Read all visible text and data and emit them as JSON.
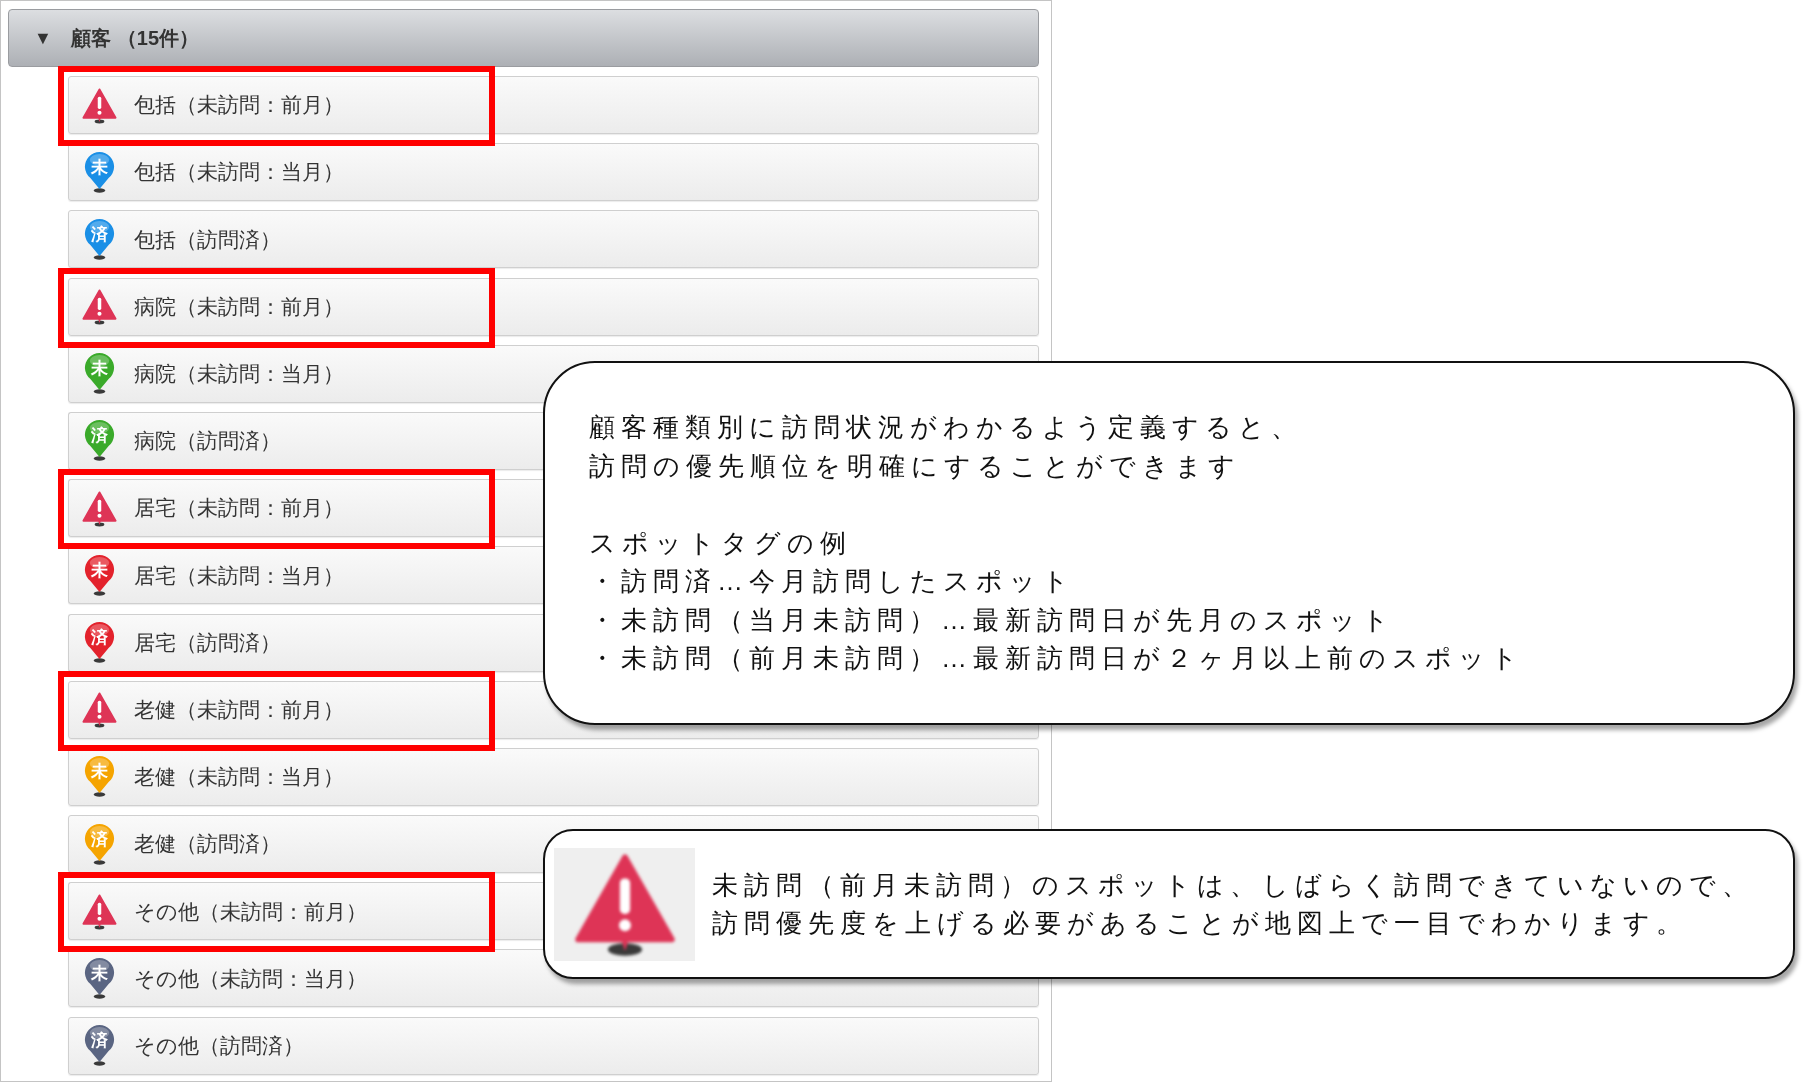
{
  "panel": {
    "header": {
      "toggle": "▼",
      "title": "顧客",
      "count": "（15件）",
      "expanded": true
    },
    "items": [
      {
        "label": "包括（未訪問：前月）",
        "kind": "alert",
        "color": "#de3456",
        "highlighted": true
      },
      {
        "label": "包括（未訪問：当月）",
        "kind": "pin",
        "pin_text": "未",
        "color": "#1a8fe6",
        "highlighted": false
      },
      {
        "label": "包括（訪問済）",
        "kind": "pin",
        "pin_text": "済",
        "color": "#1a8fe6",
        "highlighted": false
      },
      {
        "label": "病院（未訪問：前月）",
        "kind": "alert",
        "color": "#de3456",
        "highlighted": true
      },
      {
        "label": "病院（未訪問：当月）",
        "kind": "pin",
        "pin_text": "未",
        "color": "#3aaa2a",
        "highlighted": false
      },
      {
        "label": "病院（訪問済）",
        "kind": "pin",
        "pin_text": "済",
        "color": "#3aaa2a",
        "highlighted": false
      },
      {
        "label": "居宅（未訪問：前月）",
        "kind": "alert",
        "color": "#de3456",
        "highlighted": true
      },
      {
        "label": "居宅（未訪問：当月）",
        "kind": "pin",
        "pin_text": "未",
        "color": "#e3222c",
        "highlighted": false
      },
      {
        "label": "居宅（訪問済）",
        "kind": "pin",
        "pin_text": "済",
        "color": "#e3222c",
        "highlighted": false
      },
      {
        "label": "老健（未訪問：前月）",
        "kind": "alert",
        "color": "#de3456",
        "highlighted": true
      },
      {
        "label": "老健（未訪問：当月）",
        "kind": "pin",
        "pin_text": "未",
        "color": "#f5a400",
        "highlighted": false
      },
      {
        "label": "老健（訪問済）",
        "kind": "pin",
        "pin_text": "済",
        "color": "#f5a400",
        "highlighted": false
      },
      {
        "label": "その他（未訪問：前月）",
        "kind": "alert",
        "color": "#de3456",
        "highlighted": true
      },
      {
        "label": "その他（未訪問：当月）",
        "kind": "pin",
        "pin_text": "未",
        "color": "#5a6582",
        "highlighted": false
      },
      {
        "label": "その他（訪問済）",
        "kind": "pin",
        "pin_text": "済",
        "color": "#5a6582",
        "highlighted": false
      }
    ]
  },
  "callouts": [
    {
      "kind": "text",
      "intro": [
        "顧客種類別に訪問状況がわかるよう定義すると、",
        "訪問の優先順位を明確にすることができます"
      ],
      "list_title": "スポットタグの例",
      "list_items": [
        "・訪問済…今月訪問したスポット",
        "・未訪問（当月未訪問）…最新訪問日が先月のスポット",
        "・未訪問（前月未訪問）…最新訪問日が２ヶ月以上前のスポット"
      ]
    },
    {
      "kind": "icon",
      "lines": [
        "未訪問（前月未訪問）のスポットは、しばらく訪問できていないので、",
        "訪問優先度を上げる必要があることが地図上で一目でわかります。"
      ]
    }
  ]
}
